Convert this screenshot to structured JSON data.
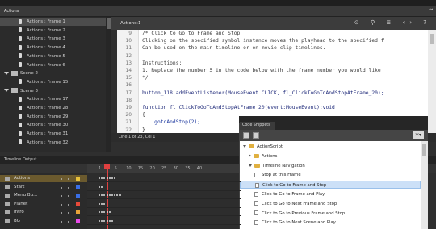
{
  "window": {
    "panel_title": "Actions",
    "collapse_glyph": "◂◂"
  },
  "tree": {
    "items": [
      {
        "label": "Actions : Frame 1",
        "type": "item"
      },
      {
        "label": "Actions : Frame 2",
        "type": "item"
      },
      {
        "label": "Actions : Frame 3",
        "type": "item"
      },
      {
        "label": "Actions : Frame 4",
        "type": "item"
      },
      {
        "label": "Actions : Frame 5",
        "type": "item"
      },
      {
        "label": "Actions : Frame 6",
        "type": "item"
      },
      {
        "label": "Scene 2",
        "type": "scene"
      },
      {
        "label": "Actions : Frame 15",
        "type": "item"
      },
      {
        "label": "Scene 3",
        "type": "scene"
      },
      {
        "label": "Actions : Frame 17",
        "type": "item"
      },
      {
        "label": "Actions : Frame 28",
        "type": "item"
      },
      {
        "label": "Actions : Frame 29",
        "type": "item"
      },
      {
        "label": "Actions : Frame 30",
        "type": "item"
      },
      {
        "label": "Actions : Frame 31",
        "type": "item"
      },
      {
        "label": "Actions : Frame 32",
        "type": "item"
      }
    ]
  },
  "editor": {
    "tab_label": "Actions:1",
    "toolbar_icons": [
      "target-icon",
      "search-icon",
      "format-icon",
      "code-icon",
      "help-icon"
    ],
    "toolbar_glyphs": "⊙ ⚲ ≣ ‹› ?",
    "line_numbers": [
      "9",
      "10",
      "11",
      "12",
      "13",
      "14",
      "15",
      "16",
      "17",
      "18",
      "19",
      "20",
      "21",
      "22"
    ],
    "lines": [
      "/* Click to Go to Frame and Stop",
      "Clicking on the specified symbol instance moves the playhead to the specified f",
      "Can be used on the main timeline or on movie clip timelines.",
      "",
      "Instructions:",
      "1. Replace the number 5 in the code below with the frame number you would like",
      "*/",
      "",
      "button_118.addEventListener(MouseEvent.CLICK, fl_ClickToGoToAndStopAtFrame_20);",
      "",
      "function fl_ClickToGoToAndStopAtFrame_20(event:MouseEvent):void",
      "{",
      "    gotoAndStop(2);",
      "}"
    ],
    "status": "Line 1 of 23, Col 1"
  },
  "timeline": {
    "tabs": [
      "Timeline",
      "Output"
    ],
    "frame_numbers": [
      "1",
      "5",
      "10",
      "15",
      "20",
      "25",
      "30",
      "35",
      "40"
    ],
    "layers": [
      {
        "name": "Actions",
        "color": "#e8c13a"
      },
      {
        "name": "Start",
        "color": "#3a6fe8"
      },
      {
        "name": "Menu Bu...",
        "color": "#3a6fe8"
      },
      {
        "name": "Planet",
        "color": "#e84a3a"
      },
      {
        "name": "Intro",
        "color": "#e8a43a"
      },
      {
        "name": "BG",
        "color": "#e84ae8"
      }
    ]
  },
  "snippets": {
    "title": "Code Snippets",
    "gear_glyph": "✲▾",
    "rows": [
      {
        "label": "ActionScript",
        "kind": "folder",
        "expanded": true,
        "indent": 0
      },
      {
        "label": "Actions",
        "kind": "folder",
        "expanded": false,
        "indent": 1
      },
      {
        "label": "Timeline Navigation",
        "kind": "folder",
        "expanded": true,
        "indent": 1
      },
      {
        "label": "Stop at this Frame",
        "kind": "file",
        "indent": 2
      },
      {
        "label": "Click to Go to Frame and Stop",
        "kind": "file",
        "indent": 2,
        "selected": true
      },
      {
        "label": "Click to Go to Frame and Play",
        "kind": "file",
        "indent": 2
      },
      {
        "label": "Click to Go to Next Frame and Stop",
        "kind": "file",
        "indent": 2
      },
      {
        "label": "Click to Go to Previous Frame and Stop",
        "kind": "file",
        "indent": 2
      },
      {
        "label": "Click to Go to Next Scene and Play",
        "kind": "file",
        "indent": 2
      }
    ]
  }
}
